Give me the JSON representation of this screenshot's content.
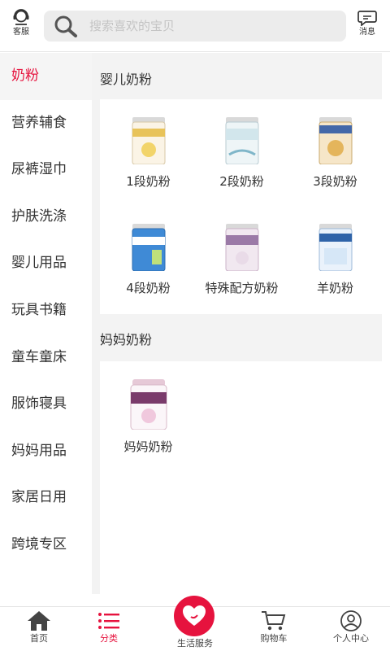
{
  "header": {
    "service_label": "客服",
    "search_placeholder": "搜索喜欢的宝贝",
    "message_label": "消息"
  },
  "sidebar": {
    "items": [
      {
        "label": "奶粉"
      },
      {
        "label": "营养辅食"
      },
      {
        "label": "尿裤湿巾"
      },
      {
        "label": "护肤洗涤"
      },
      {
        "label": "婴儿用品"
      },
      {
        "label": "玩具书籍"
      },
      {
        "label": "童车童床"
      },
      {
        "label": "服饰寝具"
      },
      {
        "label": "妈妈用品"
      },
      {
        "label": "家居日用"
      },
      {
        "label": "跨境专区"
      }
    ]
  },
  "main": {
    "sections": [
      {
        "title": "婴儿奶粉",
        "products": [
          {
            "name": "1段奶粉"
          },
          {
            "name": "2段奶粉"
          },
          {
            "name": "3段奶粉"
          },
          {
            "name": "4段奶粉"
          },
          {
            "name": "特殊配方奶粉"
          },
          {
            "name": "羊奶粉"
          }
        ]
      },
      {
        "title": "妈妈奶粉",
        "products": [
          {
            "name": "妈妈奶粉"
          }
        ]
      }
    ]
  },
  "bottom_nav": {
    "home": "首页",
    "category": "分类",
    "life_service": "生活服务",
    "cart": "购物车",
    "profile": "个人中心"
  },
  "colors": {
    "accent": "#e6133e",
    "content_bg": "#f3f3f3"
  }
}
